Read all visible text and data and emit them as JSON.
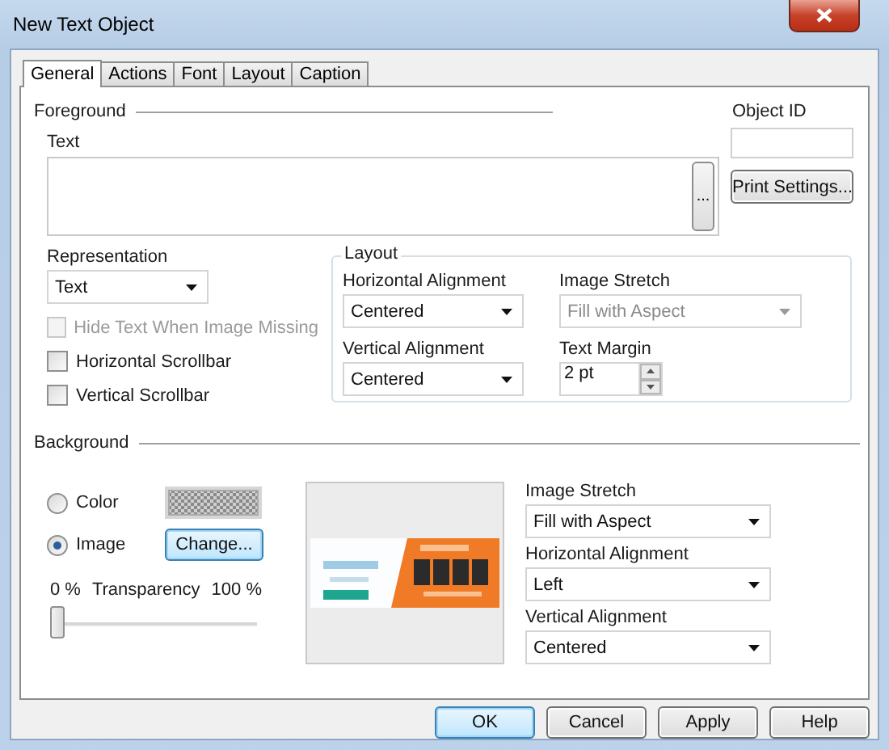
{
  "window": {
    "title": "New Text Object"
  },
  "tabs": [
    {
      "label": "General",
      "selected": true
    },
    {
      "label": "Actions",
      "selected": false
    },
    {
      "label": "Font",
      "selected": false
    },
    {
      "label": "Layout",
      "selected": false
    },
    {
      "label": "Caption",
      "selected": false
    }
  ],
  "foreground": {
    "title": "Foreground",
    "text_label": "Text",
    "browse_button": "..."
  },
  "object_id": {
    "label": "Object ID"
  },
  "print_settings_button": "Print Settings...",
  "representation": {
    "label": "Representation",
    "value": "Text"
  },
  "checkboxes": [
    {
      "label": "Hide Text When Image Missing",
      "checked": false,
      "disabled": true
    },
    {
      "label": "Horizontal Scrollbar",
      "checked": false,
      "disabled": false
    },
    {
      "label": "Vertical Scrollbar",
      "checked": false,
      "disabled": false
    }
  ],
  "layout": {
    "title": "Layout",
    "fields": [
      {
        "kind": "dropdown",
        "label": "Horizontal Alignment",
        "value": "Centered",
        "disabled": false
      },
      {
        "kind": "dropdown",
        "label": "Image Stretch",
        "value": "Fill with Aspect",
        "disabled": true
      },
      {
        "kind": "dropdown",
        "label": "Vertical Alignment",
        "value": "Centered",
        "disabled": false
      },
      {
        "kind": "spinner",
        "label": "Text Margin",
        "value": "2 pt",
        "disabled": false
      }
    ]
  },
  "background": {
    "title": "Background",
    "options": [
      {
        "kind": "swatch",
        "label": "Color",
        "selected": false
      },
      {
        "kind": "button",
        "label": "Image",
        "selected": true,
        "button": "Change...",
        "focused": true
      }
    ],
    "transparency": {
      "min": "0 %",
      "label": "Transparency",
      "max": "100 %",
      "level": 0
    },
    "fields": [
      {
        "label": "Image Stretch",
        "value": "Fill with Aspect"
      },
      {
        "label": "Horizontal Alignment",
        "value": "Left"
      },
      {
        "label": "Vertical Alignment",
        "value": "Centered"
      }
    ]
  },
  "buttons": [
    {
      "label": "OK",
      "focused": true
    },
    {
      "label": "Cancel",
      "focused": false
    },
    {
      "label": "Apply",
      "focused": false
    },
    {
      "label": "Help",
      "focused": false
    }
  ]
}
